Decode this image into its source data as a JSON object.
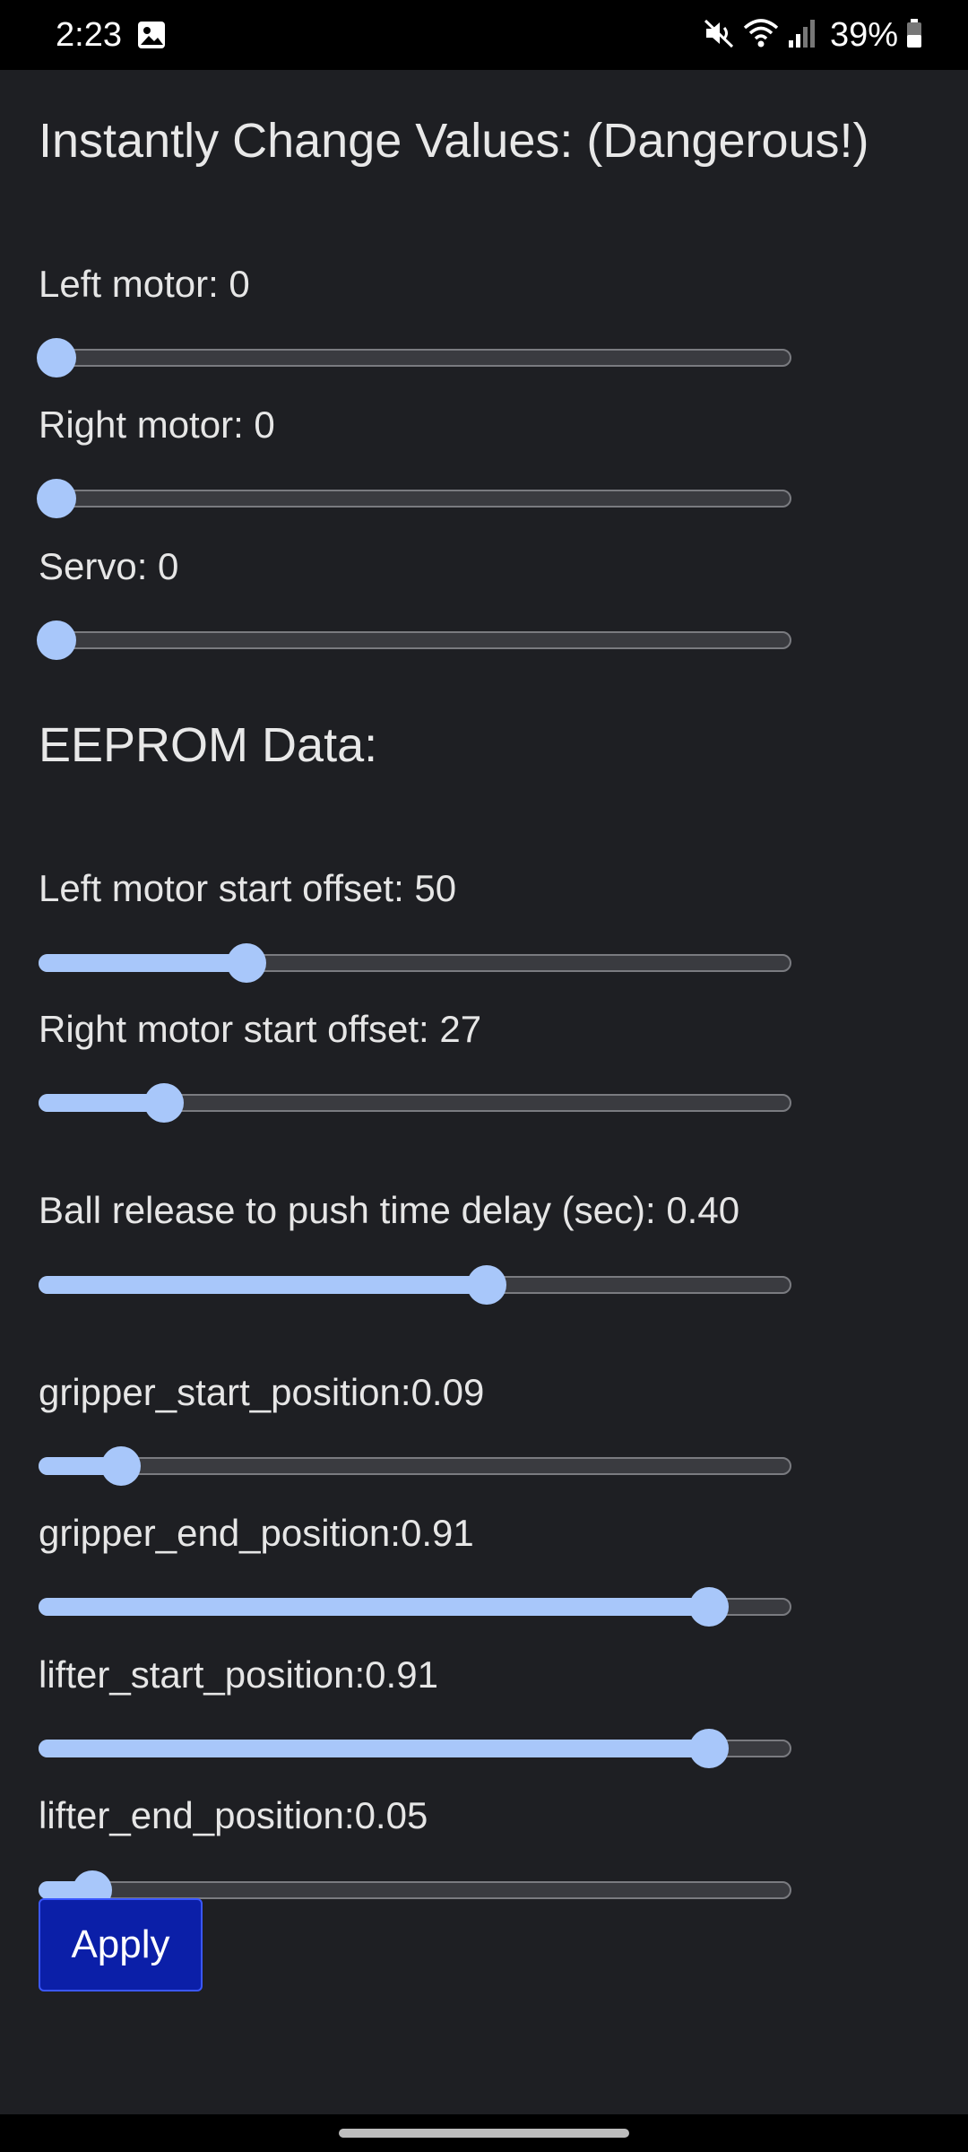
{
  "status_bar": {
    "time": "2:23",
    "battery": "39%",
    "icons": [
      "image-icon",
      "mute-icon",
      "wifi-icon",
      "signal-icon",
      "battery-icon"
    ]
  },
  "instant": {
    "title": "Instantly Change Values: (Dangerous!)",
    "sliders": [
      {
        "label": "Left motor: 0",
        "value_fraction": 0.0
      },
      {
        "label": "Right motor: 0",
        "value_fraction": 0.0
      },
      {
        "label": "Servo: 0",
        "value_fraction": 0.0
      }
    ]
  },
  "eeprom": {
    "title": "EEPROM Data:",
    "sliders": [
      {
        "label": "Left motor start offset: 50",
        "value_fraction": 0.265
      },
      {
        "label": "Right motor start offset: 27",
        "value_fraction": 0.15
      },
      {
        "label": "Ball release to push time delay (sec): 0.40",
        "value_fraction": 0.6
      },
      {
        "label": "gripper_start_position:0.09",
        "value_fraction": 0.09
      },
      {
        "label": "gripper_end_position:0.91",
        "value_fraction": 0.91
      },
      {
        "label": "lifter_start_position:0.91",
        "value_fraction": 0.91
      },
      {
        "label": "lifter_end_position:0.05",
        "value_fraction": 0.05
      }
    ]
  },
  "apply_label": "Apply",
  "colors": {
    "background": "#1e1f23",
    "slider_active": "#a8c7fa",
    "button": "#0b1fa8"
  }
}
